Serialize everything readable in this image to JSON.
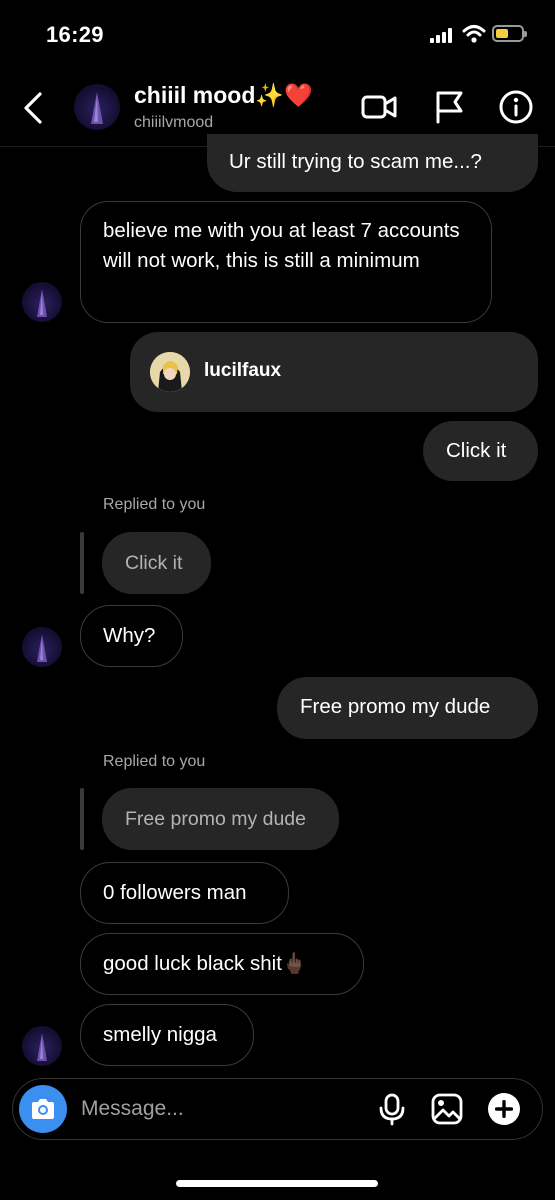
{
  "status_bar": {
    "time": "16:29",
    "battery_color": "#f4d03f"
  },
  "header": {
    "title": "chiiil mood✨❤️",
    "username": "chiiilvmood"
  },
  "conversation": {
    "messages": [
      {
        "text": "Ur still trying to scam me...?"
      },
      {
        "text": "believe me with you at least 7 accounts will not work, this is still a minimum"
      },
      {
        "shared_profile": "lucilfaux"
      },
      {
        "text": "Click it"
      },
      {
        "replied_label": "Replied to you",
        "quoted": "Click it",
        "text": "Why?"
      },
      {
        "text": "Free promo my dude"
      },
      {
        "replied_label": "Replied to you",
        "quoted": "Free promo my dude"
      },
      {
        "text": "0 followers man"
      },
      {
        "text": "good luck black shit🖕🏿"
      },
      {
        "text": "smelly nigga"
      }
    ]
  },
  "composer": {
    "placeholder": "Message..."
  },
  "colors": {
    "background": "#000000",
    "outgoing_bubble": "#262626",
    "camera_button": "#3b8ff0"
  }
}
